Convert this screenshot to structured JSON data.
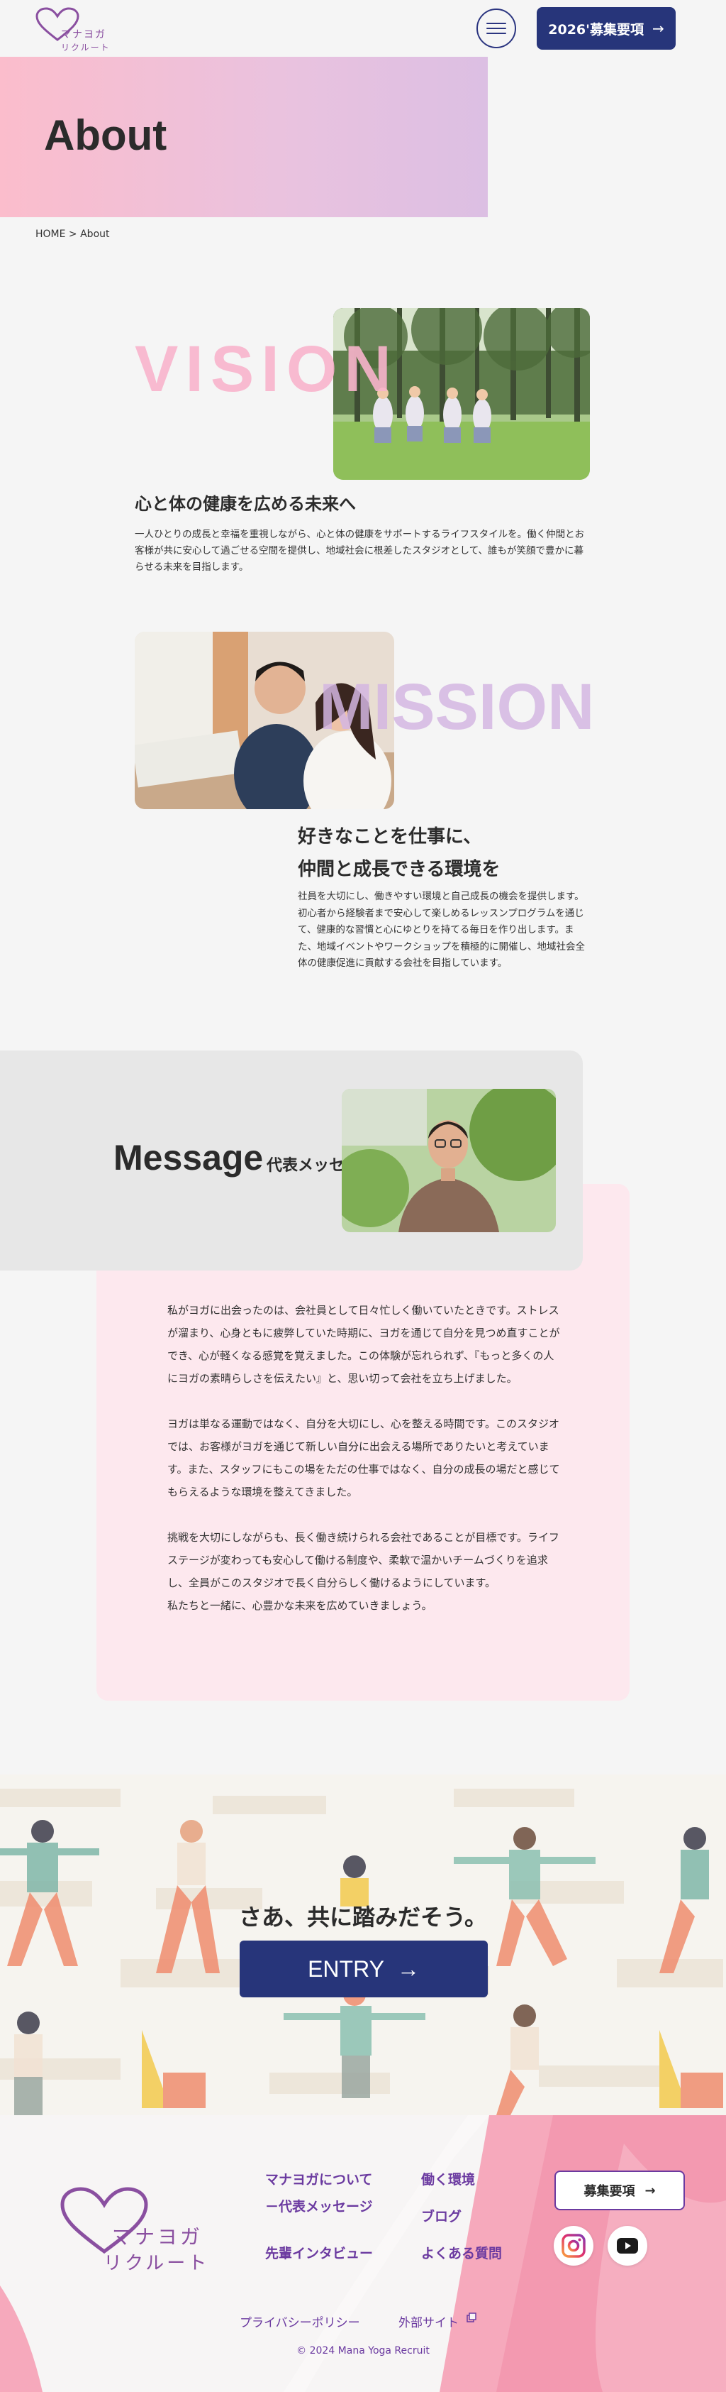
{
  "header": {
    "logo_line1": "マナヨガ",
    "logo_line2": "リクルート",
    "recruit_label": "2026'募集要項",
    "recruit_arrow": "→"
  },
  "hero": {
    "title": "About"
  },
  "breadcrumb": "HOME > About",
  "vision": {
    "word": "VISION",
    "title": "心と体の健康を広める未来へ",
    "body": "一人ひとりの成長と幸福を重視しながら、心と体の健康をサポートするライフスタイルを。働く仲間とお客様が共に安心して過ごせる空間を提供し、地域社会に根差したスタジオとして、誰もが笑顔で豊かに暮らせる未来を目指します。"
  },
  "mission": {
    "word": "MISSION",
    "title_line1": "好きなことを仕事に、",
    "title_line2": "仲間と成長できる環境を",
    "body_p1": "社員を大切にし、働きやすい環境と自己成長の機会を提供します。",
    "body_p2": "初心者から経験者まで安心して楽しめるレッスンプログラムを通じて、健康的な習慣と心にゆとりを持てる毎日を作り出します。また、地域イベントやワークショップを積極的に開催し、地域社会全体の健康促進に貢献する会社を目指しています。"
  },
  "message": {
    "title": "Message",
    "subtitle": "代表メッセージ",
    "p1": "私がヨガに出会ったのは、会社員として日々忙しく働いていたときです。ストレスが溜まり、心身ともに疲弊していた時期に、ヨガを通じて自分を見つめ直すことができ、心が軽くなる感覚を覚えました。この体験が忘れられず、『もっと多くの人にヨガの素晴らしさを伝えたい』と、思い切って会社を立ち上げました。",
    "p2": "ヨガは単なる運動ではなく、自分を大切にし、心を整える時間です。このスタジオでは、お客様がヨガを通じて新しい自分に出会える場所でありたいと考えています。また、スタッフにもこの場をただの仕事ではなく、自分の成長の場だと感じてもらえるような環境を整えてきました。",
    "p3a": "挑戦を大切にしながらも、長く働き続けられる会社であることが目標です。ライフステージが変わっても安心して働ける制度や、柔軟で温かいチームづくりを追求し、全員がこのスタジオで長く自分らしく働けるようにしています。",
    "p3b": "私たちと一緒に、心豊かな未来を広めていきましょう。"
  },
  "entry": {
    "heading": "さあ、共に踏みだそう。",
    "button_label": "ENTRY",
    "button_arrow": "→"
  },
  "footer": {
    "logo_line1": "マナヨガ",
    "logo_line2": "リクルート",
    "link_about_1": "マナヨガについて",
    "link_about_2": "－代表メッセージ",
    "link_interview": "先輩インタビュー",
    "link_environment": "働く環境",
    "link_blog": "ブログ",
    "link_faq": "よくある質問",
    "recruit_label": "募集要項",
    "recruit_arrow": "→",
    "privacy": "プライバシーポリシー",
    "external": "外部サイト",
    "copyright": "© 2024 Mana Yoga Recruit"
  },
  "colors": {
    "navy": "#27357a",
    "purple": "#6b3aa0",
    "pink": "#fbbdcc",
    "lavender": "#dcbfe3"
  },
  "icons": [
    "heart-logo-icon",
    "hamburger-menu-icon",
    "arrow-right-icon",
    "instagram-icon",
    "youtube-icon",
    "external-link-icon"
  ]
}
